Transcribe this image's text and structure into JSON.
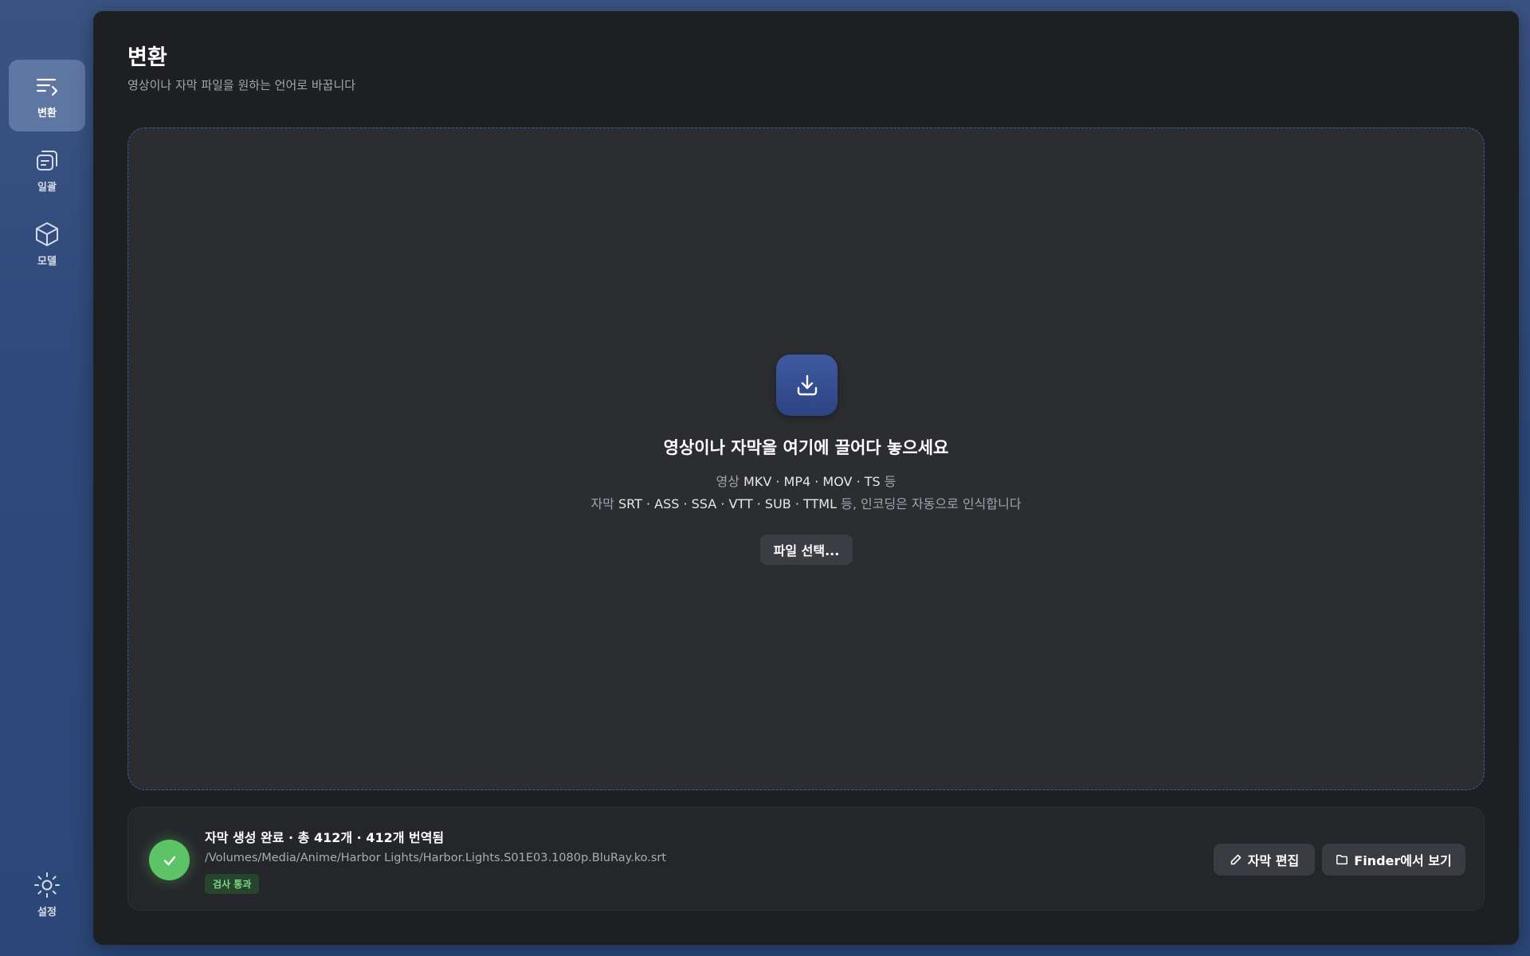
{
  "sidebar": {
    "items": [
      {
        "label": "변환",
        "icon": "convert-icon",
        "active": true
      },
      {
        "label": "일괄",
        "icon": "batch-icon",
        "active": false
      },
      {
        "label": "모델",
        "icon": "cube-icon",
        "active": false
      }
    ],
    "settings": {
      "label": "설정",
      "icon": "sun-gear-icon"
    }
  },
  "header": {
    "title": "변환",
    "subtitle": "영상이나 자막 파일을 원하는 언어로 바꿉니다"
  },
  "dropzone": {
    "icon": "download-tray-icon",
    "title": "영상이나 자막을 여기에 끌어다 놓으세요",
    "video_prefix": "영상",
    "video_formats": "MKV · MP4 · MOV · TS",
    "video_suffix": "등",
    "subtitle_prefix": "자막",
    "subtitle_formats": "SRT · ASS · SSA · VTT · SUB · TTML",
    "subtitle_suffix": "등, 인코딩은 자동으로 인식합니다",
    "choose_button": "파일 선택..."
  },
  "status": {
    "icon": "check-icon",
    "title": "자막 생성 완료 · 총 412개 · 412개 번역됨",
    "path": "/Volumes/Media/Anime/Harbor Lights/Harbor.Lights.S01E03.1080p.BluRay.ko.srt",
    "badge": "검사 통과",
    "edit_button": "자막 편집",
    "finder_button": "Finder에서 보기"
  },
  "colors": {
    "accent": "#3f5aa0",
    "success": "#5cc466",
    "background": "#1e1f22"
  }
}
